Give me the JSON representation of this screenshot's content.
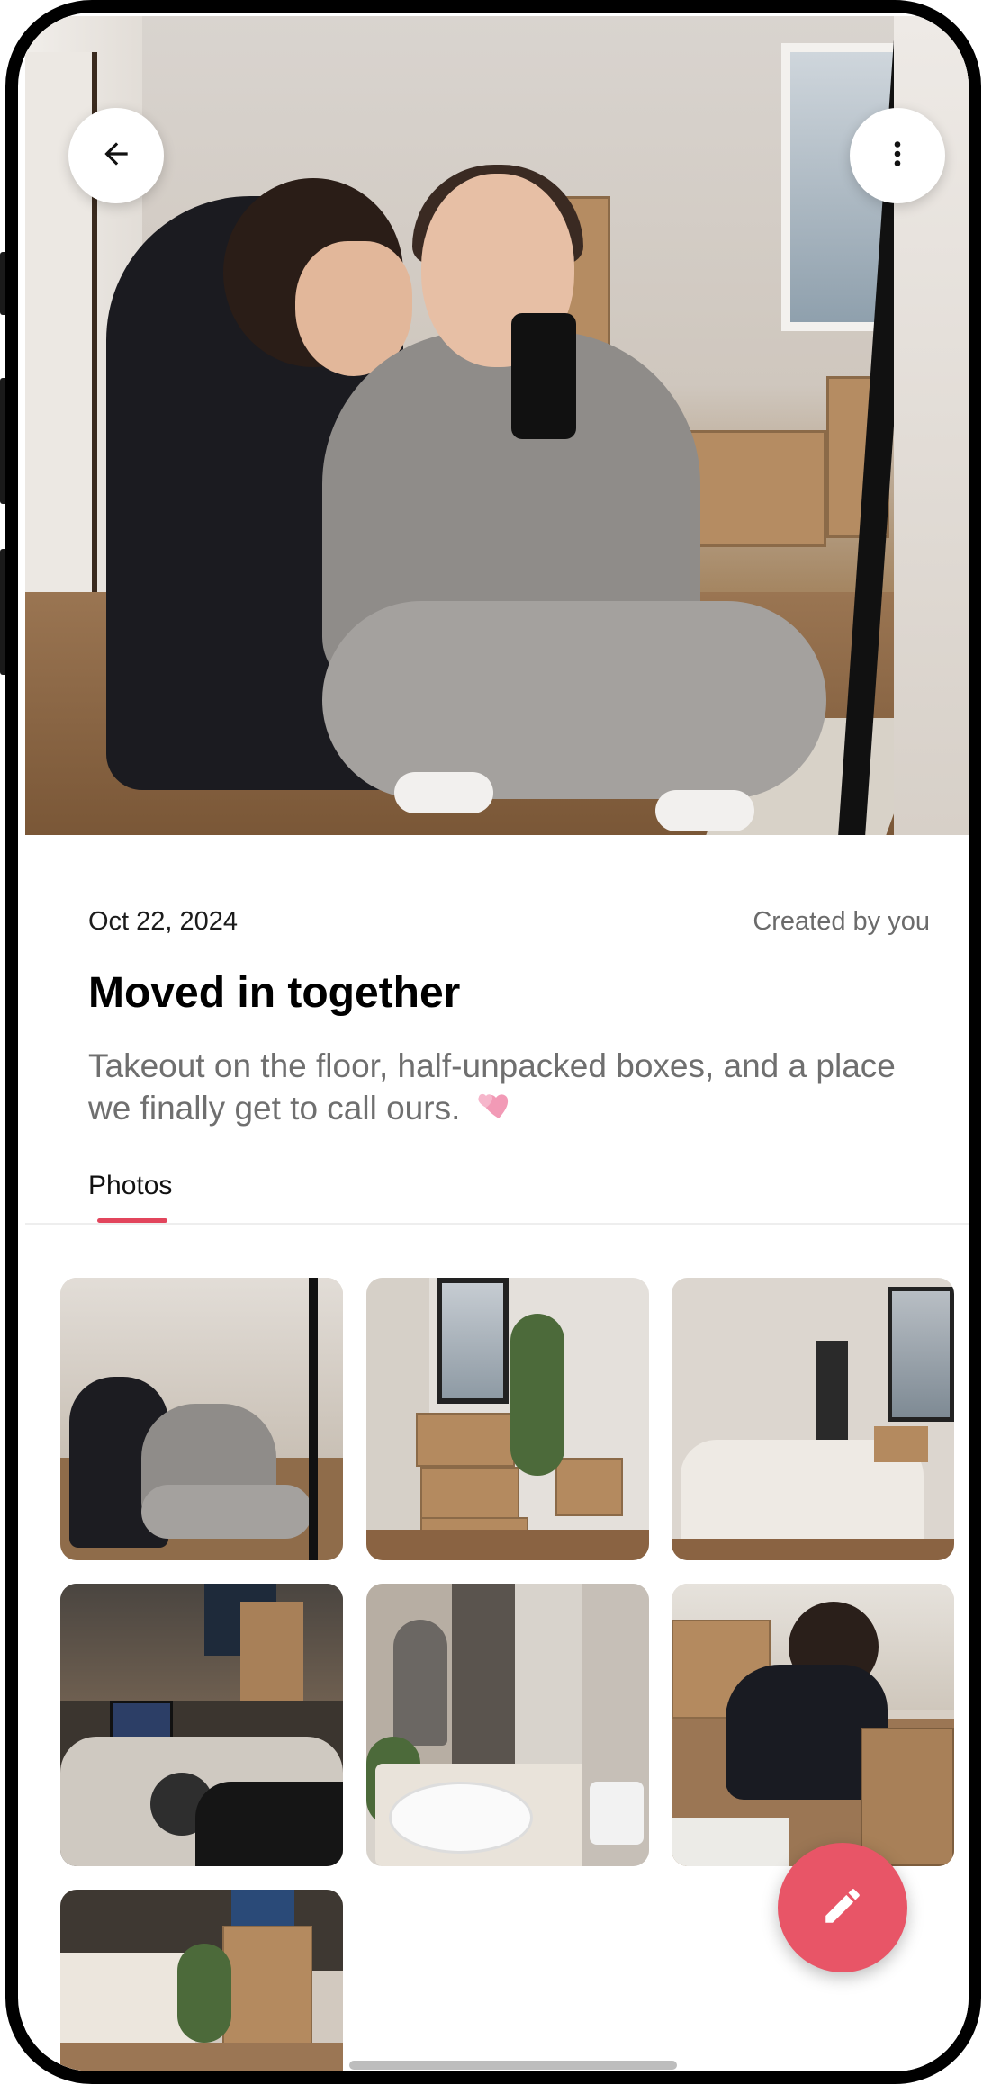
{
  "entry": {
    "date": "Oct 22, 2024",
    "created_by": "Created by you",
    "title": "Moved in together",
    "description": "Takeout on the floor, half-unpacked boxes, and a place we finally get to call ours."
  },
  "tabs": [
    {
      "label": "Photos",
      "active": true
    }
  ],
  "photos": [
    {
      "icon": "couple-selfie-photo"
    },
    {
      "icon": "stacked-boxes-photo"
    },
    {
      "icon": "bedroom-photo"
    },
    {
      "icon": "takeout-night-photo"
    },
    {
      "icon": "bathroom-sink-photo"
    },
    {
      "icon": "assembling-box-photo"
    },
    {
      "icon": "kitchen-boxes-photo"
    }
  ],
  "icons": {
    "back": "arrow-left-icon",
    "more": "more-vertical-icon",
    "fab": "pencil-icon",
    "emoji": "two-hearts-emoji"
  },
  "colors": {
    "accent": "#e2455c",
    "fab": "#e85567",
    "title": "#000000",
    "secondary_text": "#6f6f6f"
  }
}
